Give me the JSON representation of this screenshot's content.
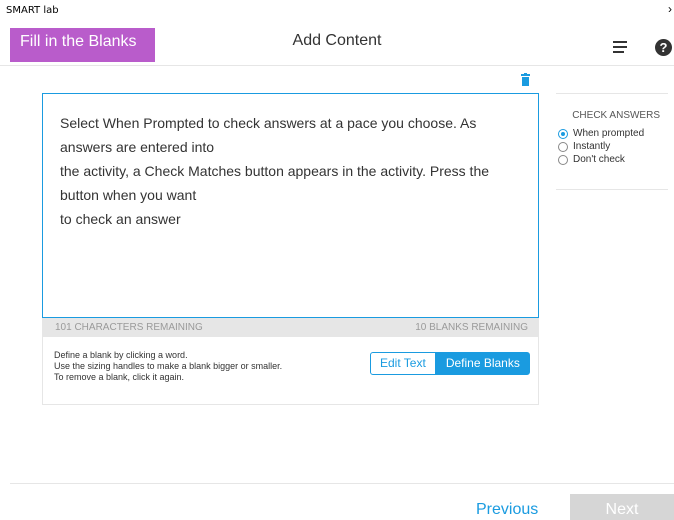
{
  "app": {
    "title": "SMART lab"
  },
  "header": {
    "activity_label": "Fill in the Blanks",
    "title": "Add Content",
    "icons": [
      "menu-icon",
      "help-icon"
    ],
    "help_glyph": "?"
  },
  "editor": {
    "lines": [
      "Select When Prompted to check answers at a pace you choose. As answers are entered into",
      "the activity, a Check Matches button appears in the activity. Press the button when you want",
      "to check an answer"
    ],
    "characters_remaining": "101 CHARACTERS REMAINING",
    "blanks_remaining": "10 BLANKS REMAINING"
  },
  "instructions": {
    "lines": [
      "Define a blank by clicking a word.",
      "Use the sizing handles to make a blank bigger or smaller.",
      "To remove a blank, click it again."
    ]
  },
  "mode": {
    "edit_label": "Edit Text",
    "define_label": "Define Blanks",
    "selected": "Define Blanks"
  },
  "check_answers": {
    "title": "CHECK ANSWERS",
    "options": [
      "When prompted",
      "Instantly",
      "Don't check"
    ],
    "selected": "When prompted"
  },
  "footer": {
    "previous_label": "Previous",
    "next_label": "Next"
  },
  "colors": {
    "accent": "#1a9be0",
    "activity_badge": "#b95ccb",
    "disabled": "#d6d6d6"
  }
}
